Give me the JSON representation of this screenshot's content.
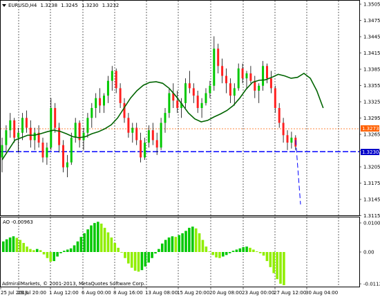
{
  "symbol_header": {
    "menu_icon": "triangle-down-icon",
    "symbol": "EURUSD,H4",
    "open": "1.3238",
    "high": "1.3245",
    "low": "1.3230",
    "close": "1.3232"
  },
  "price_axis": {
    "labels": [
      "1.3505",
      "1.3475",
      "1.3445",
      "1.3415",
      "1.3385",
      "1.3355",
      "1.3325",
      "1.3295",
      "1.3265",
      "1.3235",
      "1.3205",
      "1.3175",
      "1.3145",
      "1.3115"
    ],
    "bid_tag": "1.3230",
    "level_tag": "1.3273"
  },
  "indicator": {
    "title": "AO -0.00963",
    "axis_labels": [
      "0.01007",
      "0.00",
      "-0.01123"
    ]
  },
  "time_axis": {
    "labels": [
      "25 Jul 2013",
      "29 Jul 20:00",
      "1 Aug 12:00",
      "6 Aug 00:00",
      "8 Aug 16:00",
      "13 Aug 08:00",
      "15 Aug 20:00",
      "20 Aug 08:00",
      "23 Aug 00:00",
      "27 Aug 12:00",
      "30 Aug 04:00"
    ]
  },
  "copyright": "AdmiralMarkets, © 2001-2013, MetaQuotes Software Corp.",
  "colors": {
    "bull": "#00c800",
    "bear": "#ff2020",
    "wick": "#000000",
    "ma": "#006400",
    "bid_line": "#0000ff",
    "level_line": "#ff6000",
    "ao_up": "#00c800",
    "ao_down": "#90ee00",
    "grid": "#000000"
  },
  "chart_data": {
    "type": "candlestick",
    "symbol": "EURUSD",
    "timeframe": "H4",
    "ylim": [
      1.31,
      1.352
    ],
    "moving_average": [
      1.3205,
      1.3225,
      1.3245,
      1.325,
      1.3255,
      1.3255,
      1.3258,
      1.3262,
      1.3265,
      1.3263,
      1.3258,
      1.3252,
      1.325,
      1.3252,
      1.3258,
      1.3262,
      1.3268,
      1.3276,
      1.329,
      1.331,
      1.333,
      1.3345,
      1.3356,
      1.3362,
      1.3363,
      1.336,
      1.335,
      1.3335,
      1.3318,
      1.33,
      1.3288,
      1.3282,
      1.3285,
      1.3292,
      1.3298,
      1.3305,
      1.3315,
      1.333,
      1.3348,
      1.3362,
      1.3366,
      1.3367,
      1.3372,
      1.3378,
      1.3375,
      1.337,
      1.3372,
      1.338,
      1.337,
      1.3345,
      1.331
    ],
    "candles": [
      [
        1.321,
        1.325,
        1.318,
        1.3235
      ],
      [
        1.3235,
        1.3275,
        1.322,
        1.3265
      ],
      [
        1.3265,
        1.33,
        1.325,
        1.3285
      ],
      [
        1.3285,
        1.329,
        1.324,
        1.325
      ],
      [
        1.325,
        1.327,
        1.322,
        1.326
      ],
      [
        1.326,
        1.33,
        1.3245,
        1.329
      ],
      [
        1.329,
        1.3305,
        1.326,
        1.327
      ],
      [
        1.327,
        1.3285,
        1.323,
        1.3245
      ],
      [
        1.3245,
        1.327,
        1.3225,
        1.326
      ],
      [
        1.326,
        1.3275,
        1.323,
        1.324
      ],
      [
        1.324,
        1.325,
        1.32,
        1.321
      ],
      [
        1.321,
        1.324,
        1.3195,
        1.323
      ],
      [
        1.323,
        1.333,
        1.3225,
        1.331
      ],
      [
        1.331,
        1.332,
        1.326,
        1.327
      ],
      [
        1.327,
        1.328,
        1.322,
        1.3235
      ],
      [
        1.3235,
        1.3245,
        1.318,
        1.319
      ],
      [
        1.319,
        1.3215,
        1.317,
        1.32
      ],
      [
        1.32,
        1.326,
        1.3195,
        1.325
      ],
      [
        1.325,
        1.329,
        1.324,
        1.328
      ],
      [
        1.328,
        1.3285,
        1.323,
        1.3245
      ],
      [
        1.3245,
        1.327,
        1.3225,
        1.326
      ],
      [
        1.326,
        1.33,
        1.325,
        1.329
      ],
      [
        1.329,
        1.332,
        1.327,
        1.331
      ],
      [
        1.331,
        1.334,
        1.329,
        1.333
      ],
      [
        1.333,
        1.335,
        1.33,
        1.3315
      ],
      [
        1.3315,
        1.334,
        1.33,
        1.3335
      ],
      [
        1.3335,
        1.3375,
        1.332,
        1.3365
      ],
      [
        1.3365,
        1.3395,
        1.3345,
        1.3385
      ],
      [
        1.3385,
        1.339,
        1.334,
        1.335
      ],
      [
        1.335,
        1.336,
        1.331,
        1.332
      ],
      [
        1.332,
        1.333,
        1.328,
        1.329
      ],
      [
        1.329,
        1.33,
        1.325,
        1.326
      ],
      [
        1.326,
        1.328,
        1.324,
        1.327
      ],
      [
        1.327,
        1.328,
        1.3235,
        1.3245
      ],
      [
        1.3245,
        1.326,
        1.32,
        1.321
      ],
      [
        1.321,
        1.325,
        1.3205,
        1.324
      ],
      [
        1.324,
        1.3275,
        1.323,
        1.3265
      ],
      [
        1.3265,
        1.328,
        1.3235,
        1.3245
      ],
      [
        1.3245,
        1.326,
        1.3215,
        1.323
      ],
      [
        1.323,
        1.329,
        1.3225,
        1.328
      ],
      [
        1.328,
        1.331,
        1.326,
        1.33
      ],
      [
        1.33,
        1.335,
        1.329,
        1.334
      ],
      [
        1.334,
        1.336,
        1.331,
        1.3325
      ],
      [
        1.3325,
        1.3345,
        1.33,
        1.331
      ],
      [
        1.331,
        1.333,
        1.329,
        1.332
      ],
      [
        1.332,
        1.337,
        1.331,
        1.336
      ],
      [
        1.336,
        1.3385,
        1.334,
        1.335
      ],
      [
        1.335,
        1.336,
        1.332,
        1.3335
      ],
      [
        1.3335,
        1.3345,
        1.33,
        1.331
      ],
      [
        1.331,
        1.333,
        1.329,
        1.332
      ],
      [
        1.332,
        1.335,
        1.3315,
        1.334
      ],
      [
        1.334,
        1.3365,
        1.333,
        1.3355
      ],
      [
        1.3355,
        1.3455,
        1.3345,
        1.343
      ],
      [
        1.343,
        1.344,
        1.338,
        1.3395
      ],
      [
        1.3395,
        1.341,
        1.336,
        1.3375
      ],
      [
        1.3375,
        1.339,
        1.334,
        1.336
      ],
      [
        1.336,
        1.337,
        1.332,
        1.3335
      ],
      [
        1.3335,
        1.336,
        1.3315,
        1.335
      ],
      [
        1.335,
        1.34,
        1.3345,
        1.339
      ],
      [
        1.339,
        1.34,
        1.336,
        1.337
      ],
      [
        1.337,
        1.3385,
        1.335,
        1.338
      ],
      [
        1.338,
        1.3395,
        1.336,
        1.3365
      ],
      [
        1.3365,
        1.3375,
        1.333,
        1.3345
      ],
      [
        1.3345,
        1.336,
        1.332,
        1.3355
      ],
      [
        1.3355,
        1.3405,
        1.3345,
        1.3395
      ],
      [
        1.3395,
        1.34,
        1.336,
        1.337
      ],
      [
        1.337,
        1.3385,
        1.334,
        1.335
      ],
      [
        1.335,
        1.3355,
        1.33,
        1.331
      ],
      [
        1.331,
        1.332,
        1.327,
        1.328
      ],
      [
        1.328,
        1.329,
        1.324,
        1.3255
      ],
      [
        1.3255,
        1.3265,
        1.3225,
        1.324
      ],
      [
        1.324,
        1.3262,
        1.3228,
        1.325
      ],
      [
        1.325,
        1.3255,
        1.3225,
        1.3232
      ]
    ],
    "ao": [
      0.0035,
      0.0042,
      0.0048,
      0.0052,
      0.0047,
      0.004,
      0.003,
      0.0018,
      0.001,
      0.0006,
      0.001,
      0.0006,
      -0.0008,
      -0.002,
      -0.0032,
      -0.003,
      -0.0015,
      -0.0004,
      0.0004,
      0.0008,
      0.0012,
      0.0022,
      0.0035,
      0.005,
      0.0062,
      0.0075,
      0.0088,
      0.0096,
      0.01,
      0.0094,
      0.008,
      0.0065,
      0.0048,
      0.003,
      0.0014,
      -0.0002,
      -0.002,
      -0.0038,
      -0.0052,
      -0.0062,
      -0.0065,
      -0.006,
      -0.0048,
      -0.0035,
      -0.002,
      -0.0005,
      0.001,
      0.0028,
      0.004,
      0.0048,
      0.0052,
      0.005,
      0.0056,
      0.0062,
      0.007,
      0.008,
      0.0084,
      0.0078,
      0.0062,
      0.004,
      0.0018,
      0.0002,
      -0.001,
      -0.0018,
      -0.002,
      -0.0015,
      -0.001,
      -0.0004,
      0.0004,
      0.0008,
      0.0012,
      0.0016,
      0.0018,
      0.0014,
      0.0008,
      0.0002,
      -0.0004,
      -0.0012,
      -0.003,
      -0.005,
      -0.007,
      -0.009,
      -0.0105,
      -0.011
    ],
    "forecast": [
      [
        428,
        1.3245
      ],
      [
        435,
        1.3115
      ]
    ]
  }
}
